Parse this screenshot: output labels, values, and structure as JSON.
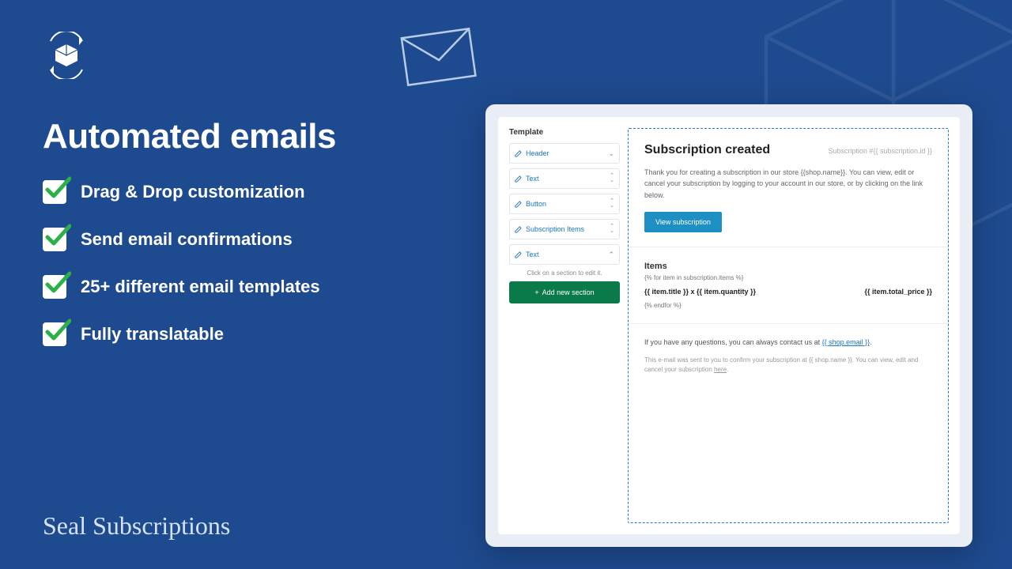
{
  "hero": {
    "title": "Automated emails",
    "features": [
      "Drag & Drop customization",
      "Send email confirmations",
      "25+ different email templates",
      "Fully translatable"
    ]
  },
  "brand": "Seal Subscriptions",
  "editor": {
    "sidebar_title": "Template",
    "sections": [
      {
        "label": "Header",
        "arrows": "down"
      },
      {
        "label": "Text",
        "arrows": "both"
      },
      {
        "label": "Button",
        "arrows": "both"
      },
      {
        "label": "Subscription Items",
        "arrows": "both"
      },
      {
        "label": "Text",
        "arrows": "up"
      }
    ],
    "hint": "Click on a section to edit it.",
    "add_button": "Add new section"
  },
  "preview": {
    "title": "Subscription created",
    "sub_id": "Subscription #{{ subscription.id }}",
    "body": "Thank you for creating a subscription in our store {{shop.name}}. You can view, edit or cancel your subscription by logging to your account in our store, or by clicking on the link below.",
    "view_button": "View subscription",
    "items_heading": "Items",
    "for_loop": "{% for item in subscription.items %}",
    "item_title": "{{ item.title }} x {{ item.quantity }}",
    "item_price": "{{ item.total_price }}",
    "endfor": "{% endfor %}",
    "questions_prefix": "If you have any questions, you can always contact us at ",
    "questions_link": "{{ shop.email }}",
    "questions_suffix": ".",
    "footer_prefix": "This e-mail was sent to you to confirm your subscription at {{ shop.name }}. You can view, edit and cancel your subscription ",
    "footer_link": "here",
    "footer_suffix": "."
  }
}
